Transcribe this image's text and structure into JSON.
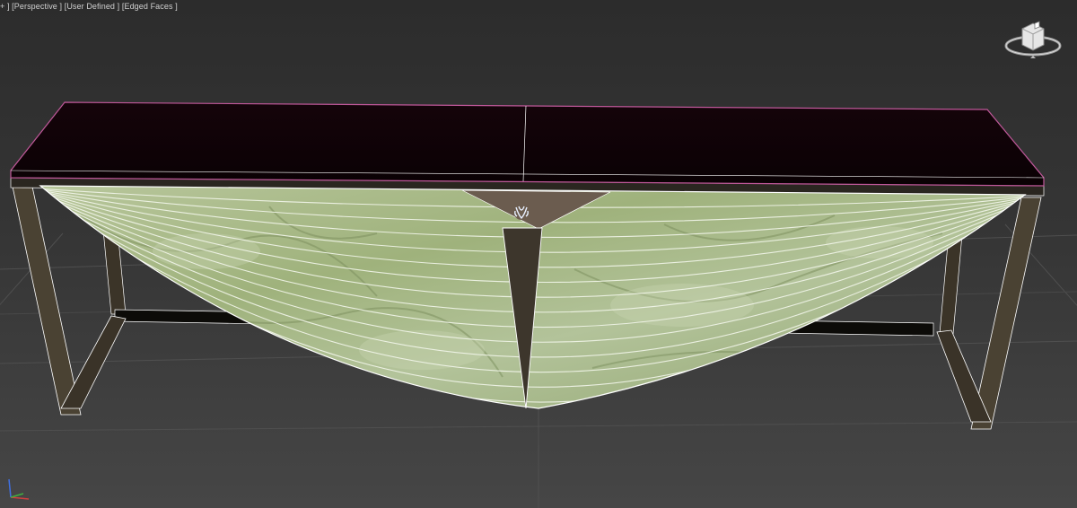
{
  "viewport": {
    "label_prefix": "+ ]",
    "label_view": "[Perspective ]",
    "label_shading": "[User Defined ]",
    "label_edges": "[Edged Faces ]"
  },
  "icons": {
    "viewcube": "viewcube-icon",
    "axis": "axis-tripod-icon"
  },
  "colors": {
    "viewport_bg": "#3a3a3a",
    "grid_line": "#4e4e4e",
    "selection_outline": "#c0589a",
    "wire": "#ffffff",
    "onyx": "#a3b684",
    "frame": "#4a4233",
    "table_top": "#0f0206"
  }
}
